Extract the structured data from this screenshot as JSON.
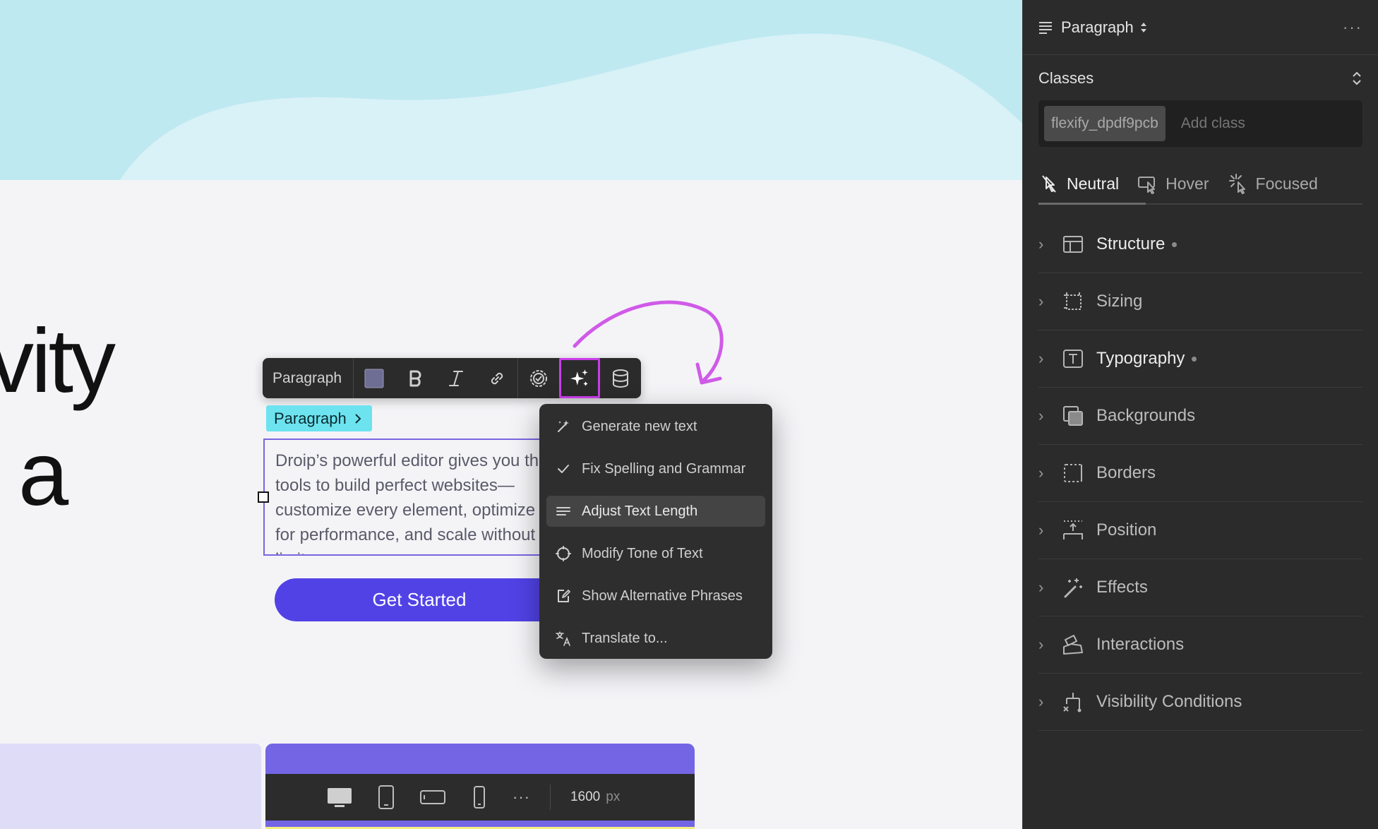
{
  "canvas": {
    "heading_line_1": "vity",
    "heading_line_2": "a",
    "toolbar": {
      "tag_label": "Paragraph",
      "text_color": "#6e6e94"
    },
    "element_label": "Paragraph",
    "paragraph_text": "Droip’s powerful editor gives you the tools to build perfect websites—customize every element, optimize for performance, and scale without limits.",
    "cta_label": "Get Started",
    "ai_menu": {
      "items": [
        {
          "label": "Generate new text",
          "icon": "magic-wand-icon"
        },
        {
          "label": "Fix Spelling and Grammar",
          "icon": "check-icon"
        },
        {
          "label": "Adjust Text Length",
          "icon": "lines-icon",
          "active": true
        },
        {
          "label": "Modify Tone of Text",
          "icon": "tone-icon"
        },
        {
          "label": "Show Alternative Phrases",
          "icon": "edit-square-icon"
        },
        {
          "label": "Translate to...",
          "icon": "translate-icon"
        }
      ]
    },
    "device_bar": {
      "width_value": "1600",
      "width_unit": "px",
      "more": "···"
    },
    "colors": {
      "accent": "#5142e6",
      "highlight": "#c93ee8",
      "label_bg": "#6ce3ef"
    }
  },
  "panel": {
    "element_type": "Paragraph",
    "more": "···",
    "classes_label": "Classes",
    "class_chip": "flexify_dpdf9pcb",
    "add_class_placeholder": "Add class",
    "states": [
      {
        "label": "Neutral",
        "active": true
      },
      {
        "label": "Hover"
      },
      {
        "label": "Focused"
      }
    ],
    "sections": [
      {
        "label": "Structure",
        "modified": true
      },
      {
        "label": "Sizing"
      },
      {
        "label": "Typography",
        "modified": true
      },
      {
        "label": "Backgrounds"
      },
      {
        "label": "Borders"
      },
      {
        "label": "Position"
      },
      {
        "label": "Effects"
      },
      {
        "label": "Interactions"
      },
      {
        "label": "Visibility Conditions"
      }
    ]
  }
}
